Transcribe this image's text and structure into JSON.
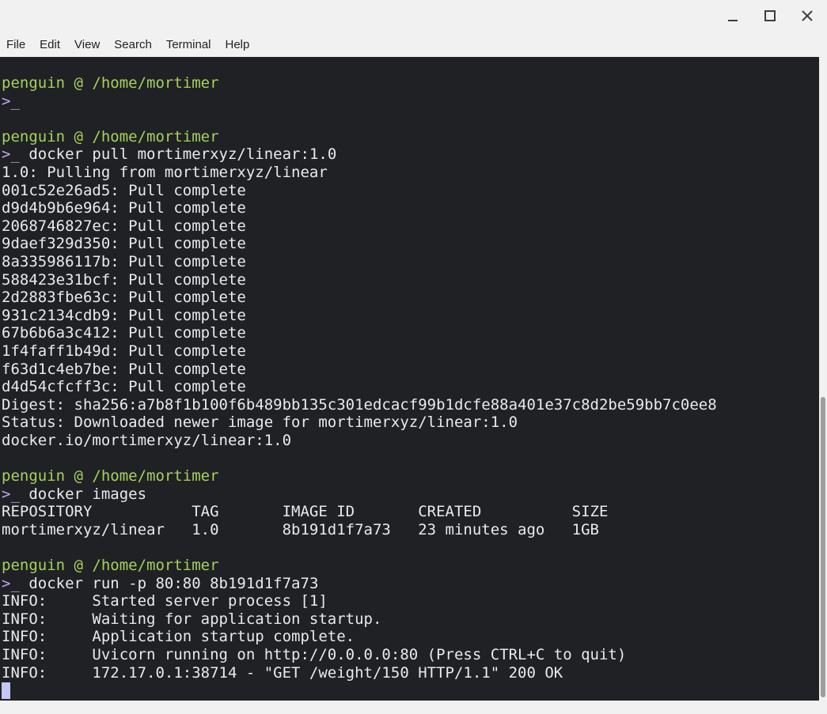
{
  "window": {
    "controls": [
      "minimize-icon",
      "maximize-icon",
      "close-icon"
    ]
  },
  "menu": [
    "File",
    "Edit",
    "View",
    "Search",
    "Terminal",
    "Help"
  ],
  "colors": {
    "terminal_bg": "#202124",
    "prompt": "#a6d15c",
    "caret": "#c7a2f0",
    "text": "#e8eaed"
  },
  "terminal": {
    "lines": [
      {
        "type": "prompt",
        "text": "penguin @ /home/mortimer"
      },
      {
        "type": "command",
        "caret": ">_",
        "text": ""
      },
      {
        "type": "blank",
        "text": ""
      },
      {
        "type": "prompt",
        "text": "penguin @ /home/mortimer"
      },
      {
        "type": "command",
        "caret": ">_",
        "text": " docker pull mortimerxyz/linear:1.0"
      },
      {
        "type": "output",
        "text": "1.0: Pulling from mortimerxyz/linear"
      },
      {
        "type": "output",
        "text": "001c52e26ad5: Pull complete"
      },
      {
        "type": "output",
        "text": "d9d4b9b6e964: Pull complete"
      },
      {
        "type": "output",
        "text": "2068746827ec: Pull complete"
      },
      {
        "type": "output",
        "text": "9daef329d350: Pull complete"
      },
      {
        "type": "output",
        "text": "8a335986117b: Pull complete"
      },
      {
        "type": "output",
        "text": "588423e31bcf: Pull complete"
      },
      {
        "type": "output",
        "text": "2d2883fbe63c: Pull complete"
      },
      {
        "type": "output",
        "text": "931c2134cdb9: Pull complete"
      },
      {
        "type": "output",
        "text": "67b6b6a3c412: Pull complete"
      },
      {
        "type": "output",
        "text": "1f4faff1b49d: Pull complete"
      },
      {
        "type": "output",
        "text": "f63d1c4eb7be: Pull complete"
      },
      {
        "type": "output",
        "text": "d4d54cfcff3c: Pull complete"
      },
      {
        "type": "output",
        "text": "Digest: sha256:a7b8f1b100f6b489bb135c301edcacf99b1dcfe88a401e37c8d2be59bb7c0ee8"
      },
      {
        "type": "output",
        "text": "Status: Downloaded newer image for mortimerxyz/linear:1.0"
      },
      {
        "type": "output",
        "text": "docker.io/mortimerxyz/linear:1.0"
      },
      {
        "type": "blank",
        "text": ""
      },
      {
        "type": "prompt",
        "text": "penguin @ /home/mortimer"
      },
      {
        "type": "command",
        "caret": ">_",
        "text": " docker images"
      },
      {
        "type": "output",
        "text": "REPOSITORY           TAG       IMAGE ID       CREATED          SIZE"
      },
      {
        "type": "output",
        "text": "mortimerxyz/linear   1.0       8b191d1f7a73   23 minutes ago   1GB"
      },
      {
        "type": "blank",
        "text": ""
      },
      {
        "type": "prompt",
        "text": "penguin @ /home/mortimer"
      },
      {
        "type": "command",
        "caret": ">_",
        "text": " docker run -p 80:80 8b191d1f7a73"
      },
      {
        "type": "output",
        "text": "INFO:     Started server process [1]"
      },
      {
        "type": "output",
        "text": "INFO:     Waiting for application startup."
      },
      {
        "type": "output",
        "text": "INFO:     Application startup complete."
      },
      {
        "type": "output",
        "text": "INFO:     Uvicorn running on http://0.0.0.0:80 (Press CTRL+C to quit)"
      },
      {
        "type": "output",
        "text": "INFO:     172.17.0.1:38714 - \"GET /weight/150 HTTP/1.1\" 200 OK"
      },
      {
        "type": "cursor",
        "text": ""
      }
    ]
  }
}
